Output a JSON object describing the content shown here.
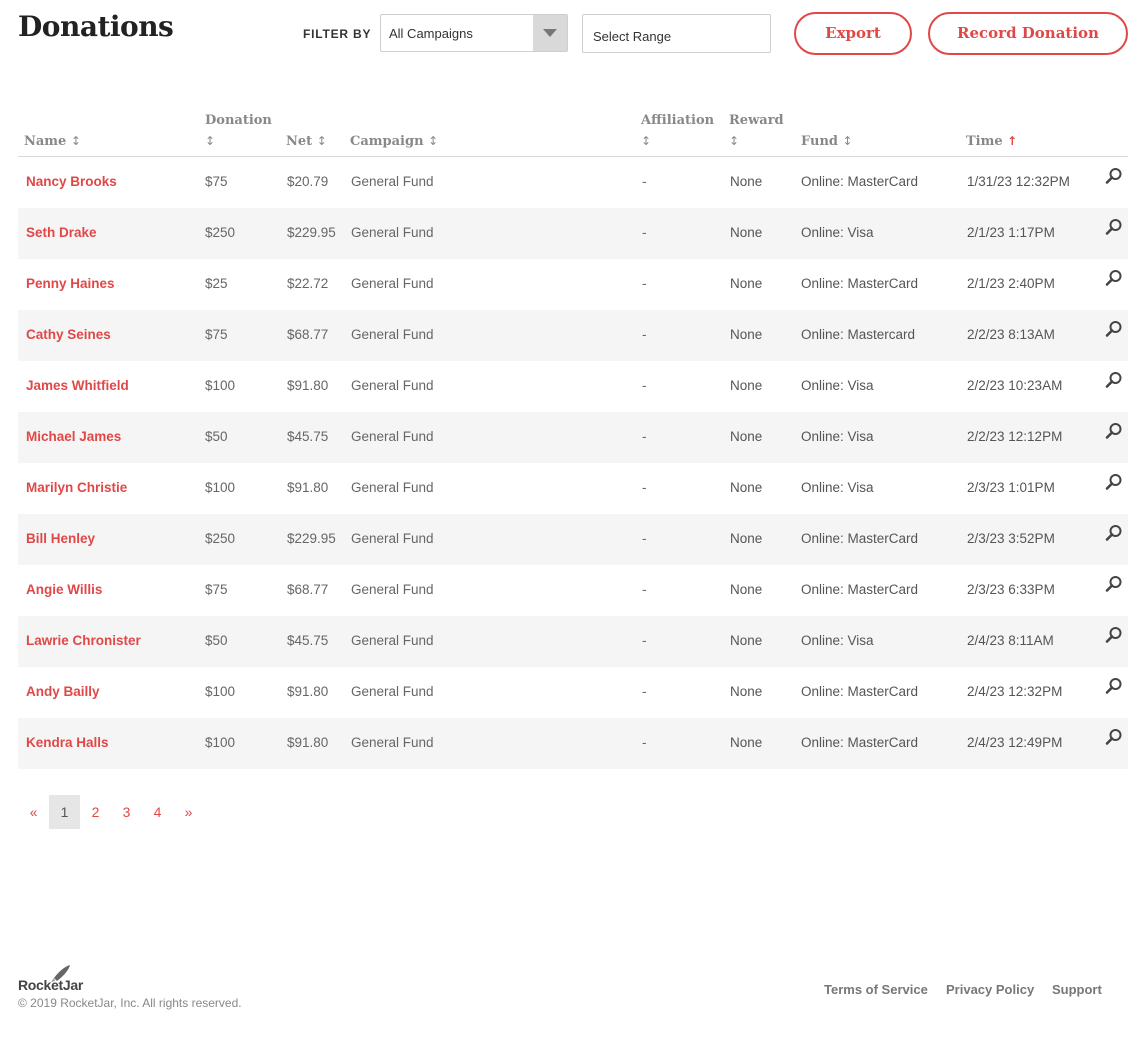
{
  "header": {
    "title": "Donations",
    "filter_label": "FILTER BY",
    "campaign_select": "All Campaigns",
    "range_placeholder": "Select Range",
    "export_label": "Export",
    "record_label": "Record Donation"
  },
  "colors": {
    "accent": "#e04848",
    "row_alt": "#f5f5f5"
  },
  "table": {
    "columns": [
      {
        "label": "Name",
        "sort": "↕"
      },
      {
        "label": "Donation",
        "sort": "↕"
      },
      {
        "label": "Net",
        "sort": "↕"
      },
      {
        "label": "Campaign",
        "sort": "↕"
      },
      {
        "label": "Affiliation",
        "sort": "↕"
      },
      {
        "label": "Reward",
        "sort": "↕"
      },
      {
        "label": "Fund",
        "sort": "↕"
      },
      {
        "label": "Time",
        "sort": "↑"
      }
    ],
    "row_action_icon": "magnifier-icon",
    "rows": [
      {
        "name": "Nancy Brooks",
        "donation": "$75",
        "net": "$20.79",
        "campaign": "General Fund",
        "affiliation": "-",
        "reward": "None",
        "fund": "Online: MasterCard",
        "time": "1/31/23 12:32PM"
      },
      {
        "name": "Seth Drake",
        "donation": "$250",
        "net": "$229.95",
        "campaign": "General Fund",
        "affiliation": "-",
        "reward": "None",
        "fund": "Online: Visa",
        "time": "2/1/23 1:17PM"
      },
      {
        "name": "Penny Haines",
        "donation": "$25",
        "net": "$22.72",
        "campaign": "General Fund",
        "affiliation": "-",
        "reward": "None",
        "fund": "Online: MasterCard",
        "time": "2/1/23 2:40PM"
      },
      {
        "name": "Cathy Seines",
        "donation": "$75",
        "net": "$68.77",
        "campaign": "General Fund",
        "affiliation": "-",
        "reward": "None",
        "fund": "Online: Mastercard",
        "time": "2/2/23 8:13AM"
      },
      {
        "name": "James Whitfield",
        "donation": "$100",
        "net": "$91.80",
        "campaign": "General Fund",
        "affiliation": "-",
        "reward": "None",
        "fund": "Online: Visa",
        "time": "2/2/23 10:23AM"
      },
      {
        "name": "Michael James",
        "donation": "$50",
        "net": "$45.75",
        "campaign": "General Fund",
        "affiliation": "-",
        "reward": "None",
        "fund": "Online: Visa",
        "time": "2/2/23 12:12PM"
      },
      {
        "name": "Marilyn Christie",
        "donation": "$100",
        "net": "$91.80",
        "campaign": "General Fund",
        "affiliation": "-",
        "reward": "None",
        "fund": "Online: Visa",
        "time": "2/3/23 1:01PM"
      },
      {
        "name": "Bill Henley",
        "donation": "$250",
        "net": "$229.95",
        "campaign": "General Fund",
        "affiliation": "-",
        "reward": "None",
        "fund": "Online: MasterCard",
        "time": "2/3/23 3:52PM"
      },
      {
        "name": "Angie Willis",
        "donation": "$75",
        "net": "$68.77",
        "campaign": "General Fund",
        "affiliation": "-",
        "reward": "None",
        "fund": "Online: MasterCard",
        "time": "2/3/23 6:33PM"
      },
      {
        "name": "Lawrie Chronister",
        "donation": "$50",
        "net": "$45.75",
        "campaign": "General Fund",
        "affiliation": "-",
        "reward": "None",
        "fund": "Online: Visa",
        "time": "2/4/23 8:11AM"
      },
      {
        "name": "Andy Bailly",
        "donation": "$100",
        "net": "$91.80",
        "campaign": "General Fund",
        "affiliation": "-",
        "reward": "None",
        "fund": "Online: MasterCard",
        "time": "2/4/23 12:32PM"
      },
      {
        "name": "Kendra Halls",
        "donation": "$100",
        "net": "$91.80",
        "campaign": "General Fund",
        "affiliation": "-",
        "reward": "None",
        "fund": "Online: MasterCard",
        "time": "2/4/23 12:49PM"
      }
    ]
  },
  "pagination": {
    "prev": "«",
    "pages": [
      "1",
      "2",
      "3",
      "4"
    ],
    "current": "1",
    "next": "»"
  },
  "footer": {
    "logo_icon": "rocket-icon",
    "brand": "RocketJar",
    "copyright": "© 2019 RocketJar, Inc. All rights reserved.",
    "links": [
      "Terms of Service",
      "Privacy Policy",
      "Support"
    ]
  }
}
